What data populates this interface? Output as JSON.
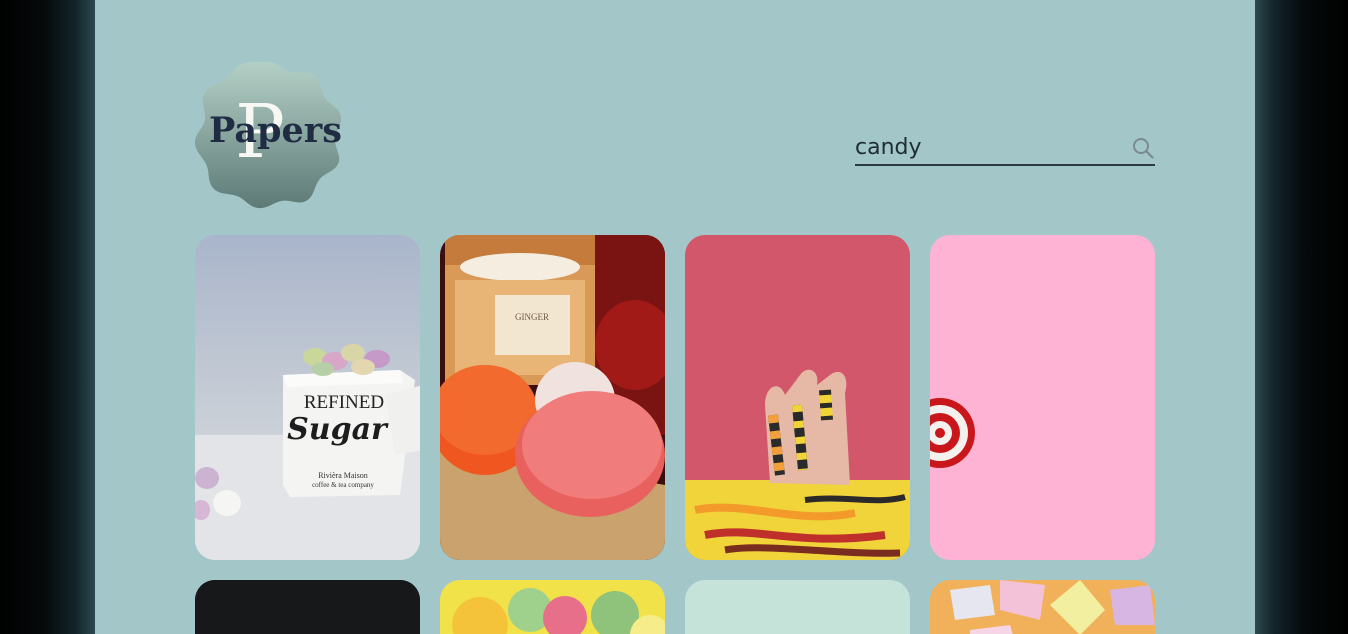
{
  "logo": {
    "letter": "P",
    "text": "Papers"
  },
  "search": {
    "value": "candy"
  },
  "results": [
    {
      "name": "candy-photo-sugar-jar",
      "engraved_text": [
        "REFINED",
        "Sugar",
        "Rivièra Maison",
        "coffee & tea company"
      ]
    },
    {
      "name": "candy-photo-macarons-candle",
      "engraved_text": [
        "GINGER"
      ]
    },
    {
      "name": "candy-photo-gummy-worms-hand"
    },
    {
      "name": "candy-photo-lollipop-pink"
    },
    {
      "name": "candy-photo-dark"
    },
    {
      "name": "candy-photo-sugar-candies"
    },
    {
      "name": "candy-photo-mint"
    },
    {
      "name": "candy-photo-candy-hearts"
    }
  ],
  "colors": {
    "page_bg": "#a3c7c9",
    "text_dark": "#1f2c44"
  }
}
